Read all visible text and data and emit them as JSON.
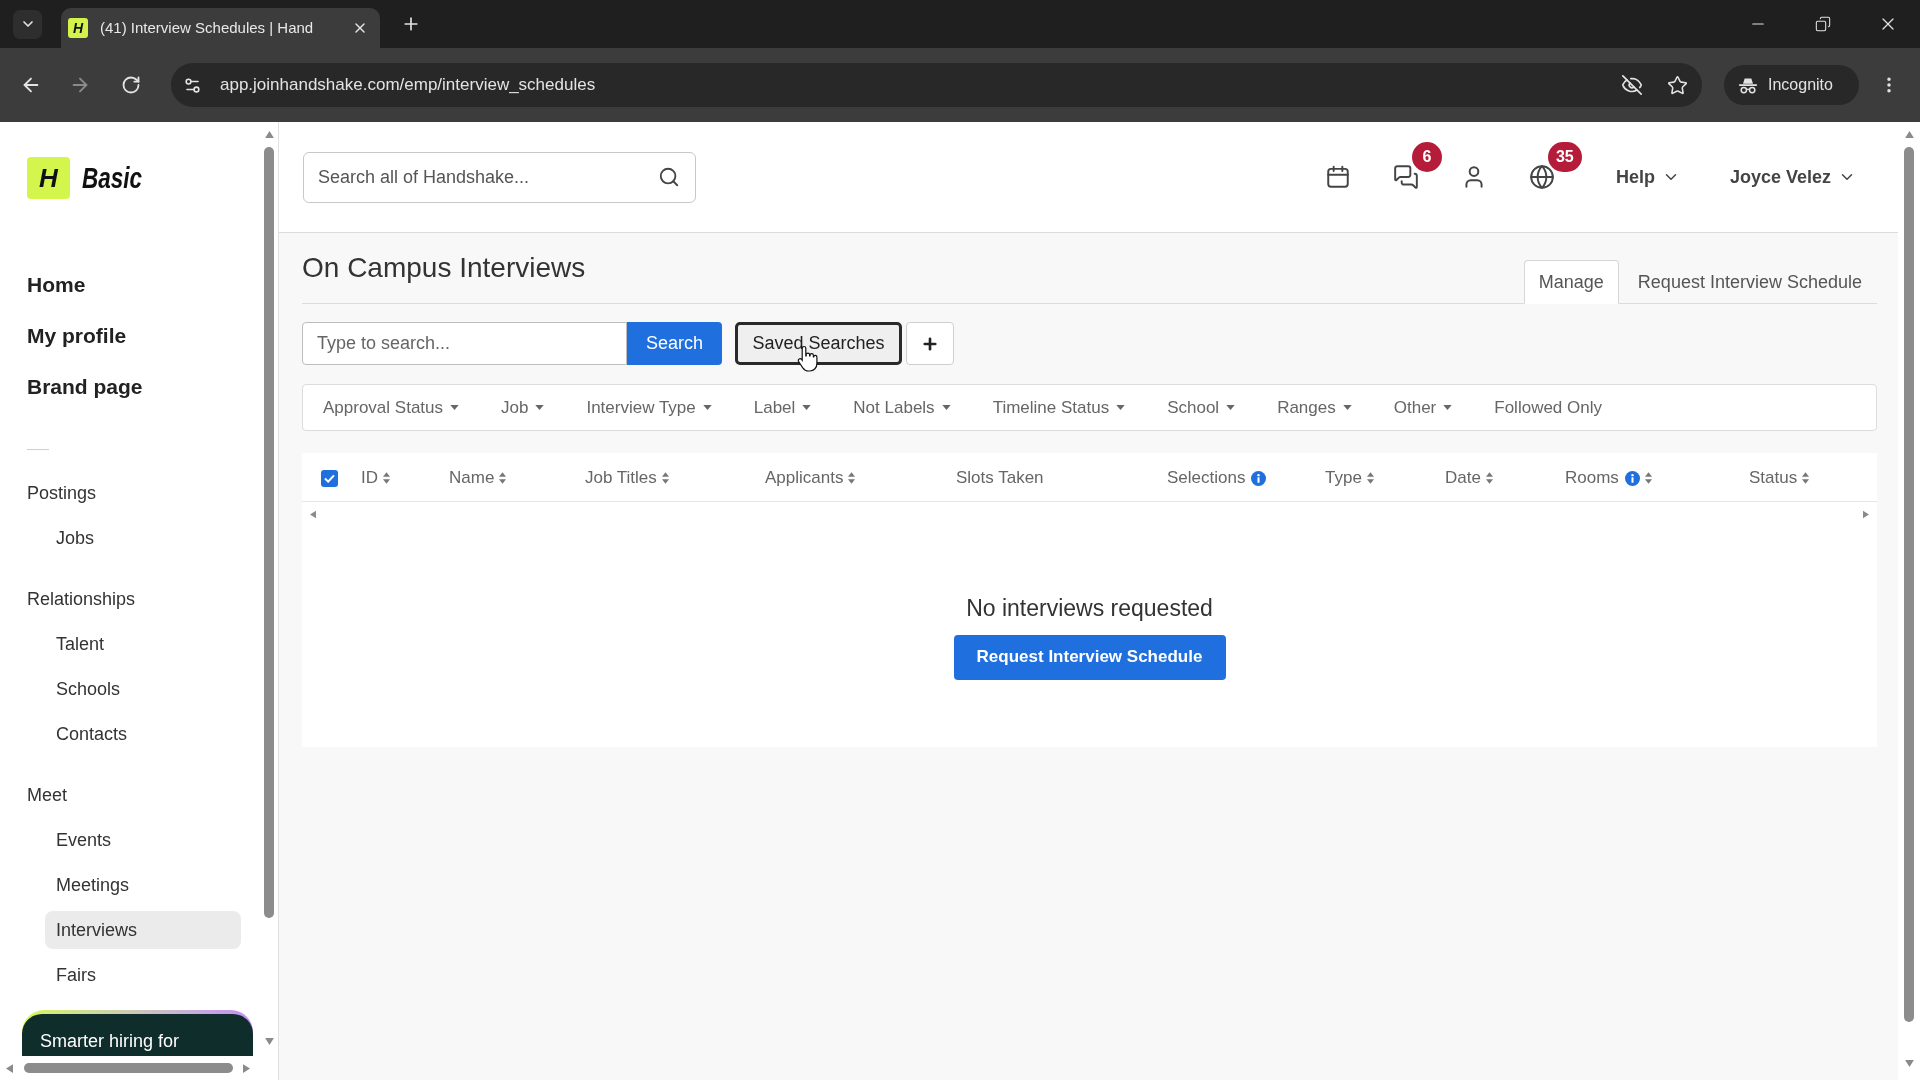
{
  "browser": {
    "favicon_letter": "H",
    "tab_title": "(41) Interview Schedules | Hand",
    "url": "app.joinhandshake.com/emp/interview_schedules",
    "profile": "Incognito"
  },
  "sidebar": {
    "logo_letter": "H",
    "brand": "Basic",
    "main_links": [
      {
        "label": "Home",
        "selected": false
      },
      {
        "label": "My profile",
        "selected": false
      },
      {
        "label": "Brand page",
        "selected": false
      }
    ],
    "sections": [
      {
        "heading": "Postings",
        "items": [
          {
            "label": "Jobs",
            "selected": false
          }
        ]
      },
      {
        "heading": "Relationships",
        "items": [
          {
            "label": "Talent",
            "selected": false
          },
          {
            "label": "Schools",
            "selected": false
          },
          {
            "label": "Contacts",
            "selected": false
          }
        ]
      },
      {
        "heading": "Meet",
        "items": [
          {
            "label": "Events",
            "selected": false
          },
          {
            "label": "Meetings",
            "selected": false
          },
          {
            "label": "Interviews",
            "selected": true
          },
          {
            "label": "Fairs",
            "selected": false
          }
        ]
      }
    ],
    "promo": "Smarter hiring for"
  },
  "header": {
    "search_placeholder": "Search all of Handshake...",
    "icons": [
      {
        "kind": "calendar"
      },
      {
        "kind": "messages",
        "badge": "6"
      },
      {
        "kind": "person"
      },
      {
        "kind": "globe",
        "badge": "35"
      }
    ],
    "menus": [
      "Help",
      "Joyce Velez"
    ]
  },
  "page": {
    "title": "On Campus Interviews",
    "tabs": [
      {
        "label": "Manage",
        "selected": true
      },
      {
        "label": "Request Interview Schedule",
        "selected": false
      }
    ]
  },
  "search": {
    "placeholder": "Type to search...",
    "button": "Search",
    "saved_button": "Saved Searches"
  },
  "filters": [
    {
      "label": "Approval Status",
      "dropdown": true
    },
    {
      "label": "Job",
      "dropdown": true
    },
    {
      "label": "Interview Type",
      "dropdown": true
    },
    {
      "label": "Label",
      "dropdown": true
    },
    {
      "label": "Not Labels",
      "dropdown": true
    },
    {
      "label": "Timeline Status",
      "dropdown": true
    },
    {
      "label": "School",
      "dropdown": true
    },
    {
      "label": "Ranges",
      "dropdown": true
    },
    {
      "label": "Other",
      "dropdown": true
    },
    {
      "label": "Followed Only",
      "dropdown": false
    }
  ],
  "table": {
    "select_all": {
      "checked": true
    },
    "columns": [
      {
        "label": "ID",
        "sortable": true,
        "info": false
      },
      {
        "label": "Name",
        "sortable": true,
        "info": false
      },
      {
        "label": "Job Titles",
        "sortable": true,
        "info": false
      },
      {
        "label": "Applicants",
        "sortable": true,
        "info": false
      },
      {
        "label": "Slots Taken",
        "sortable": false,
        "info": false
      },
      {
        "label": "Selections",
        "sortable": false,
        "info": true
      },
      {
        "label": "Type",
        "sortable": true,
        "info": false
      },
      {
        "label": "Date",
        "sortable": true,
        "info": false
      },
      {
        "label": "Rooms",
        "sortable": true,
        "info": true
      },
      {
        "label": "Status",
        "sortable": true,
        "info": false
      }
    ]
  },
  "empty_state": {
    "message": "No interviews requested",
    "button": "Request Interview Schedule"
  }
}
